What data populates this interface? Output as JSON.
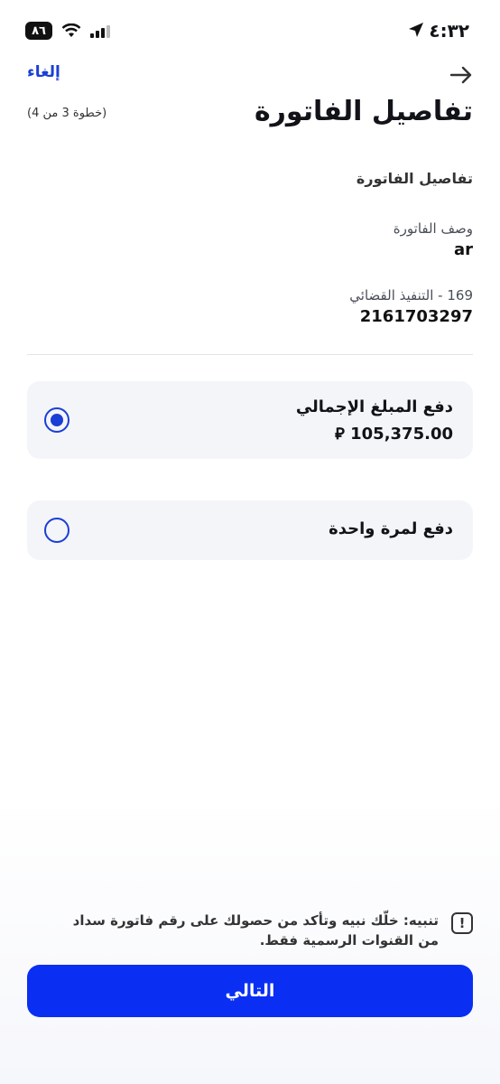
{
  "status_bar": {
    "time": "٤:٣٢",
    "battery": "٨٦"
  },
  "header": {
    "cancel_label": "إلغاء",
    "title": "تفاصيل الفاتورة",
    "step": "(خطوة 3 من 4)"
  },
  "details": {
    "section_title": "تفاصيل الفاتورة",
    "description_label": "وصف الفاتورة",
    "description_value": "ar",
    "biller_label": "169 - التنفيذ القضائي",
    "biller_value": "2161703297"
  },
  "options": [
    {
      "label": "دفع المبلغ الإجمالي",
      "amount": "105,375.00 ⃁",
      "selected": true
    },
    {
      "label": "دفع لمرة واحدة",
      "selected": false
    }
  ],
  "warning": {
    "text": "تنبيه: خلّك نبيه وتأكد من حصولك على رقم فاتورة سداد من القنوات الرسمية فقط."
  },
  "footer": {
    "next_label": "التالي"
  },
  "colors": {
    "accent": "#1a3fd6",
    "button": "#0a2ff3",
    "card": "#f4f5f9"
  }
}
